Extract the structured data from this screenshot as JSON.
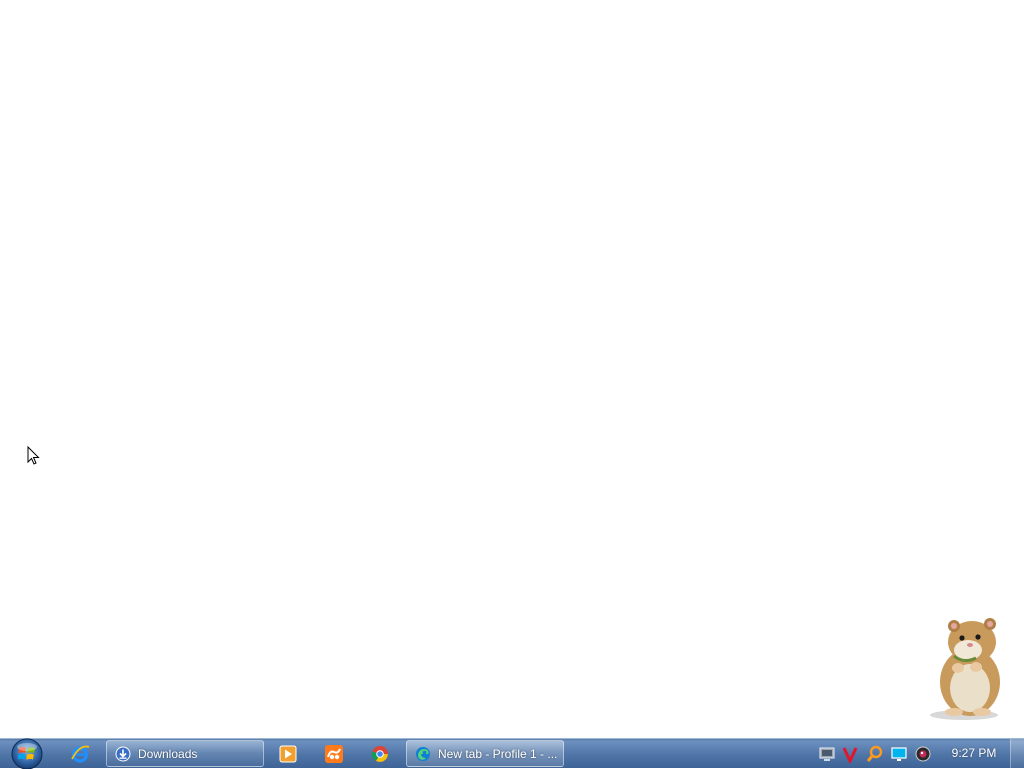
{
  "desktop": {
    "buddy": "hamster-mascot",
    "cursor": "arrow-cursor"
  },
  "taskbar": {
    "start_button": "windows-start-orb",
    "pinned": [
      {
        "icon": "internet-explorer-icon"
      },
      {
        "icon": "media-player-icon"
      },
      {
        "icon": "uc-browser-icon"
      },
      {
        "icon": "chrome-icon"
      }
    ],
    "windows": [
      {
        "label": "Downloads",
        "icon": "downloads-icon"
      },
      {
        "label": "New tab - Profile 1 - ...",
        "icon": "edge-icon",
        "active": true
      }
    ],
    "tray_icons": [
      "network-icon",
      "vivaldi-icon",
      "search-tray-icon",
      "display-icon",
      "webcam-icon"
    ],
    "clock": "9:27 PM"
  },
  "colors": {
    "taskbar": "#4f74a6",
    "desktop": "#ffffff"
  }
}
